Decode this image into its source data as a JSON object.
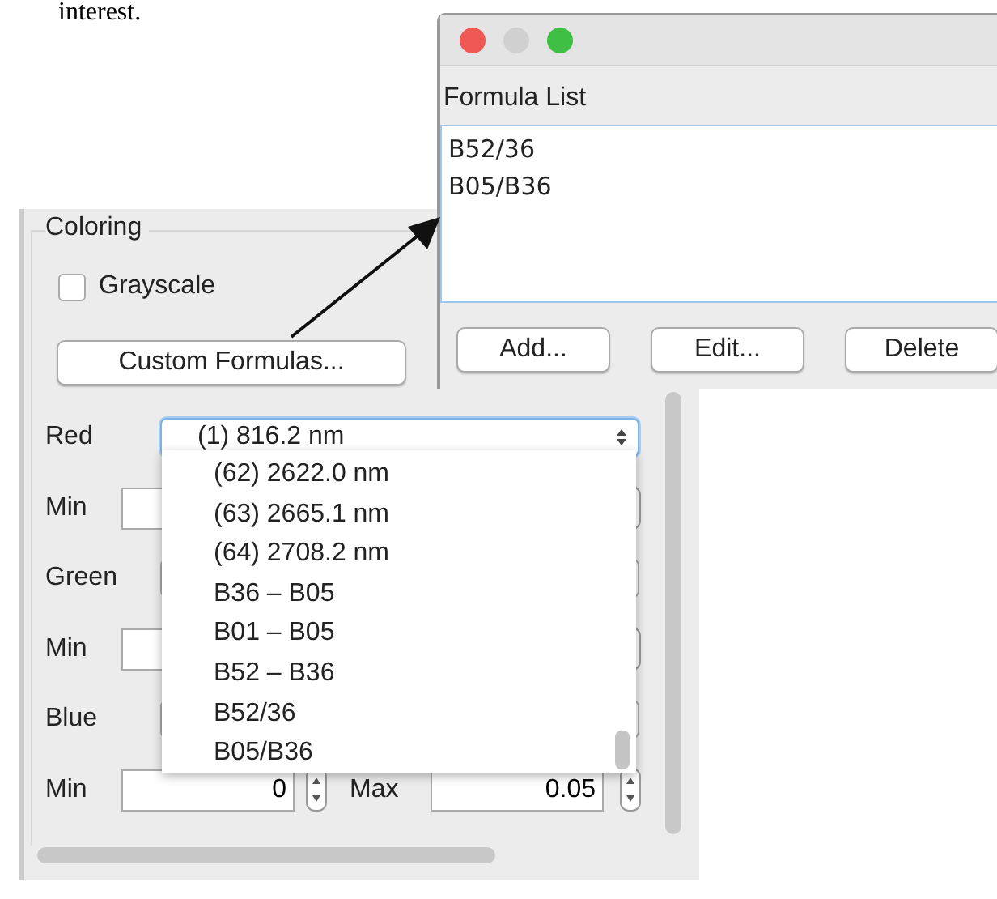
{
  "caption_fragment": "interest.",
  "panel": {
    "group_title": "Coloring",
    "grayscale": {
      "label": "Grayscale",
      "checked": false
    },
    "custom_button": "Custom Formulas...",
    "rows": [
      {
        "kind": "select",
        "label": "Red",
        "value": "(1) 816.2 nm",
        "open": true
      },
      {
        "kind": "range",
        "label": "Min"
      },
      {
        "kind": "select",
        "label": "Green",
        "open": false
      },
      {
        "kind": "range",
        "label": "Min"
      },
      {
        "kind": "select",
        "label": "Blue",
        "open": false
      },
      {
        "kind": "range",
        "label": "Min",
        "min": "0",
        "max_label": "Max",
        "max": "0.05"
      }
    ],
    "dropdown_options": [
      "(62) 2622.0 nm",
      "(63) 2665.1 nm",
      "(64) 2708.2 nm",
      "B36 – B05",
      "B01 – B05",
      "B52 – B36",
      "B52/36",
      "B05/B36"
    ]
  },
  "formula_window": {
    "list_title": "Formula List",
    "formulas": [
      "B52/36",
      "B05/B36"
    ],
    "buttons": [
      "Add...",
      "Edit...",
      "Delete"
    ]
  }
}
